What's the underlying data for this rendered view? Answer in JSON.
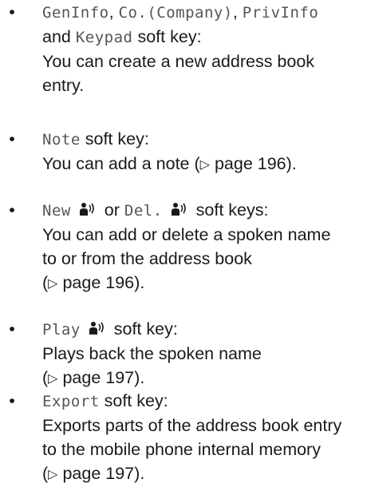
{
  "items": [
    {
      "keys": [
        "GenInfo",
        "Co.(Company)",
        "PrivInfo",
        "Keypad"
      ],
      "sep1": ", ",
      "sep2": ", ",
      "and": "and",
      "suffix": "soft key:",
      "desc_line1": "You can create a new address book",
      "desc_line2": "entry."
    },
    {
      "key": "Note",
      "suffix": "soft key:",
      "desc": "You can add a note (",
      "page": "page 196",
      "desc_end": ")."
    },
    {
      "key1": "New",
      "or": "or",
      "key2": "Del.",
      "suffix": "soft keys:",
      "desc_line1": "You can add or delete a spoken name",
      "desc_line2": "to or from the address book",
      "page": "page 196",
      "desc_end": ")."
    },
    {
      "key": "Play",
      "suffix": "soft key:",
      "desc_line1": "Plays back the spoken name",
      "page": "page 197",
      "desc_end": ")."
    },
    {
      "key": "Export",
      "suffix": "soft key:",
      "desc_line1": "Exports parts of the address book entry",
      "desc_line2": "to the mobile phone internal memory",
      "page": "page 197",
      "desc_end": ")."
    }
  ],
  "bullet_char": "•",
  "arrow_char": "▷",
  "icons": {
    "voice": "voice-name-icon"
  }
}
